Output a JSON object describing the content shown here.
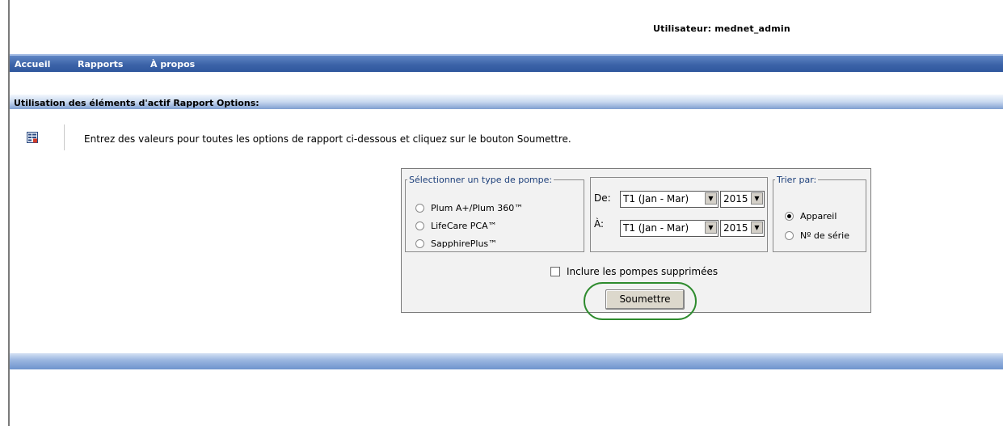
{
  "header": {
    "user_label": "Utilisateur: mednet_admin"
  },
  "nav": {
    "items": [
      "Accueil",
      "Rapports",
      "À propos"
    ]
  },
  "section": {
    "title": "Utilisation des éléments d'actif Rapport Options:"
  },
  "instructions": "Entrez des valeurs pour toutes les options de rapport ci-dessous et cliquez sur le bouton Soumettre.",
  "pump_type": {
    "legend": "Sélectionner un type de pompe:",
    "options": [
      "Plum A+/Plum 360™",
      "LifeCare PCA™",
      "SapphirePlus™"
    ],
    "selected": null
  },
  "period": {
    "from_label": "De:",
    "to_label": "À:",
    "from_quarter": "T1 (Jan - Mar)",
    "from_year": "2015",
    "to_quarter": "T1 (Jan - Mar)",
    "to_year": "2015"
  },
  "sort": {
    "legend": "Trier par:",
    "options": [
      "Appareil",
      "Nº de série"
    ],
    "selected": "Appareil"
  },
  "include_deleted": {
    "label": "Inclure les pompes supprimées",
    "checked": false
  },
  "submit_label": "Soumettre",
  "icons": {
    "info": "report-options-icon",
    "select_arrow": "dropdown-arrow-icon"
  },
  "colors": {
    "nav_bar": "#3c63a8",
    "section_bar": "#9db8e1",
    "submit_highlight": "#2e8b2e"
  }
}
